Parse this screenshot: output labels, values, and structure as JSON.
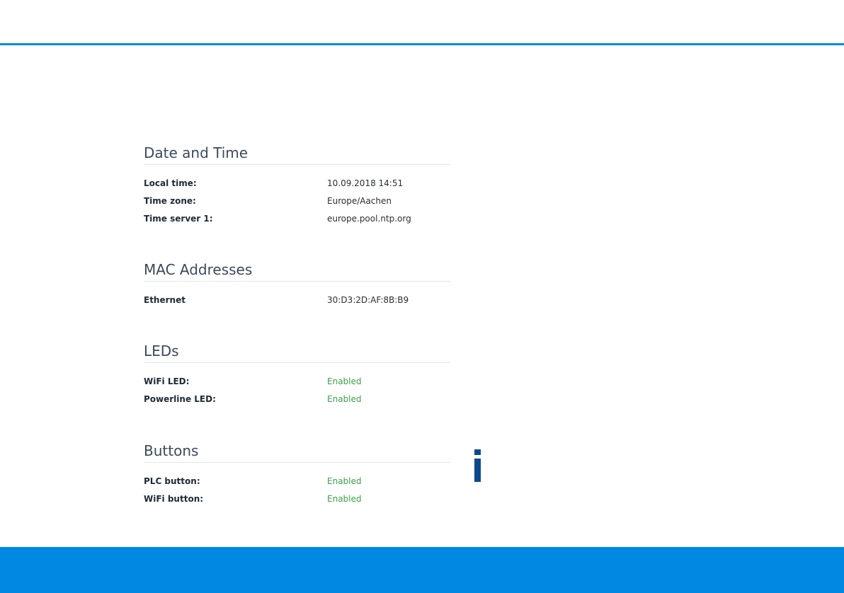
{
  "sections": [
    {
      "title": "Date and Time",
      "rows": [
        {
          "label": "Local time:",
          "value": "10.09.2018 14:51"
        },
        {
          "label": "Time zone:",
          "value": "Europe/Aachen"
        },
        {
          "label": "Time server 1:",
          "value": "europe.pool.ntp.org"
        }
      ]
    },
    {
      "title": "MAC Addresses",
      "rows": [
        {
          "label": "Ethernet",
          "value": "30:D3:2D:AF:8B:B9"
        }
      ]
    },
    {
      "title": "LEDs",
      "rows": [
        {
          "label": "WiFi LED:",
          "value": "Enabled"
        },
        {
          "label": "Powerline LED:",
          "value": "Enabled"
        }
      ]
    },
    {
      "title": "Buttons",
      "rows": [
        {
          "label": "PLC button:",
          "value": "Enabled"
        },
        {
          "label": "WiFi button:",
          "value": "Enabled"
        }
      ]
    }
  ],
  "icons": {
    "info": "info-icon"
  },
  "colors": {
    "accent": "#0088e2",
    "status_enabled": "#3aa24a",
    "info_icon": "#0a4a8a"
  }
}
